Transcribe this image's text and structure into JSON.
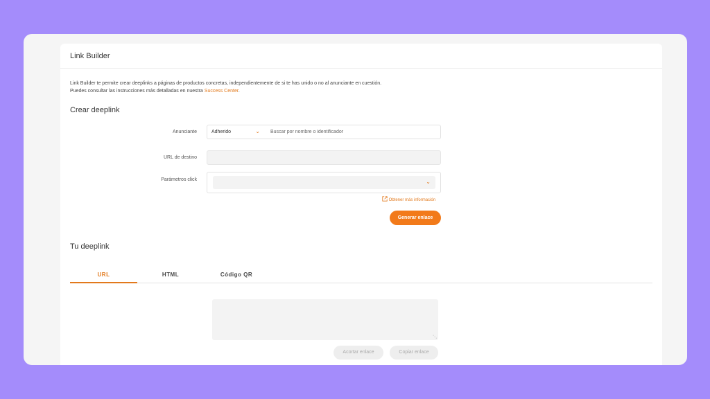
{
  "header": {
    "title": "Link Builder"
  },
  "intro": {
    "line1": "Link Builder te permite crear deeplinks a páginas de productos concretas, independientemente de si te has unido o no al anunciante en cuestión.",
    "line2_prefix": "Puedes consultar las instrucciones más detalladas en nuestra ",
    "line2_link": "Success Center",
    "line2_suffix": "."
  },
  "create": {
    "title": "Crear deeplink",
    "advertiser_label": "Anunciante",
    "advertiser_select": "Adherido",
    "advertiser_search_placeholder": "Buscar por nombre o identificador",
    "url_label": "URL de destino",
    "url_value": "",
    "params_label": "Parámetros click",
    "params_value": "",
    "more_info": "Obtener más información",
    "generate_button": "Generar enlace"
  },
  "result": {
    "title": "Tu deeplink",
    "tabs": [
      {
        "label": "URL",
        "active": true
      },
      {
        "label": "HTML",
        "active": false
      },
      {
        "label": "Código QR",
        "active": false
      }
    ],
    "output_value": "",
    "shorten_button": "Acortar enlace",
    "copy_button": "Copiar enlace"
  },
  "colors": {
    "accent": "#f27a1a",
    "background": "#a48cfb"
  }
}
